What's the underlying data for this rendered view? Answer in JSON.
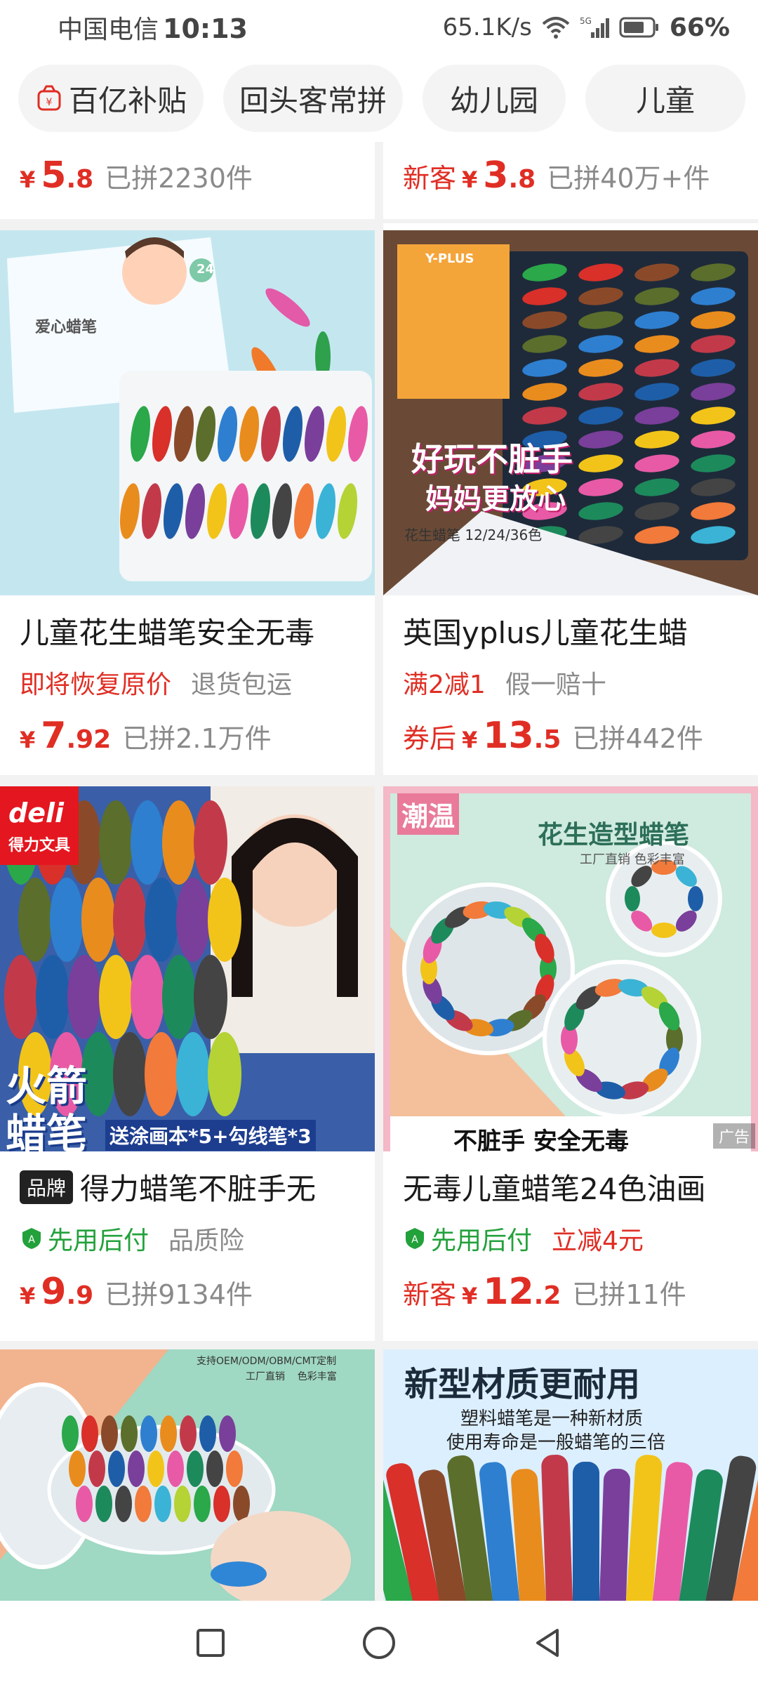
{
  "status_bar": {
    "carrier": "中国电信",
    "time": "10:13",
    "net_speed": "65.1K/s",
    "battery": "66%"
  },
  "tabs": [
    {
      "label": "百亿补贴"
    },
    {
      "label": "回头客常拼"
    },
    {
      "label": "幼儿园"
    },
    {
      "label": "儿童"
    }
  ],
  "products": {
    "top_left": {
      "yen": "¥",
      "price_int": "5",
      "price_dec": ".8",
      "sold": "已拼2230件"
    },
    "top_right": {
      "prefix": "新客",
      "yen": "¥",
      "price_int": "3",
      "price_dec": ".8",
      "sold": "已拼40万+件"
    },
    "p1": {
      "title": "儿童花生蜡笔安全无毒",
      "tag1": "即将恢复原价",
      "tag2": "退货包运",
      "yen": "¥",
      "price_int": "7",
      "price_dec": ".92",
      "sold": "已拼2.1万件",
      "img_box_label": "爱心蜡笔",
      "img_badge": "24"
    },
    "p2": {
      "title": "英国yplus儿童花生蜡",
      "tag1": "满2减1",
      "tag2": "假一赔十",
      "prefix": "券后",
      "yen": "¥",
      "price_int": "13",
      "price_dec": ".5",
      "sold": "已拼442件",
      "img_line1": "好玩不脏手",
      "img_line2": "妈妈更放心",
      "img_sub": "花生蜡笔 12/24/36色",
      "img_brand": "Y-PLUS"
    },
    "p3": {
      "badge": "品牌",
      "title": "得力蜡笔不脏手无",
      "tag1": "先用后付",
      "tag2": "品质险",
      "yen": "¥",
      "price_int": "9",
      "price_dec": ".9",
      "sold": "已拼9134件",
      "img_logo": "deli",
      "img_logo_sub": "得力文具",
      "img_big1": "火箭",
      "img_big2": "蜡笔",
      "img_banner": "送涂画本*5+勾线笔*3"
    },
    "p4": {
      "title": "无毒儿童蜡笔24色油画",
      "tag1": "先用后付",
      "tag2": "立减4元",
      "prefix": "新客",
      "yen": "¥",
      "price_int": "12",
      "price_dec": ".2",
      "sold": "已拼11件",
      "img_corner": "潮温",
      "img_title": "花生造型蜡笔",
      "img_sub": "工厂直销  色彩丰富",
      "img_bottom": "不脏手 安全无毒",
      "ad": "广告"
    },
    "p5": {
      "img_text1": "支持OEM/ODM/OBM/CMT定制",
      "img_text2": "工厂直销    色彩丰富"
    },
    "p6": {
      "img_title": "新型材质更耐用",
      "img_line1": "塑料蜡笔是一种新材质",
      "img_line2": "使用寿命是一般蜡笔的三倍"
    }
  },
  "colors": {
    "price_red": "#e02e24",
    "green": "#23a13b",
    "gray": "#8a8a8a"
  },
  "icons": [
    "wifi-icon",
    "signal-icon",
    "battery-icon",
    "red-bag-icon",
    "green-shield-icon",
    "square-nav-icon",
    "circle-nav-icon",
    "back-nav-icon"
  ]
}
